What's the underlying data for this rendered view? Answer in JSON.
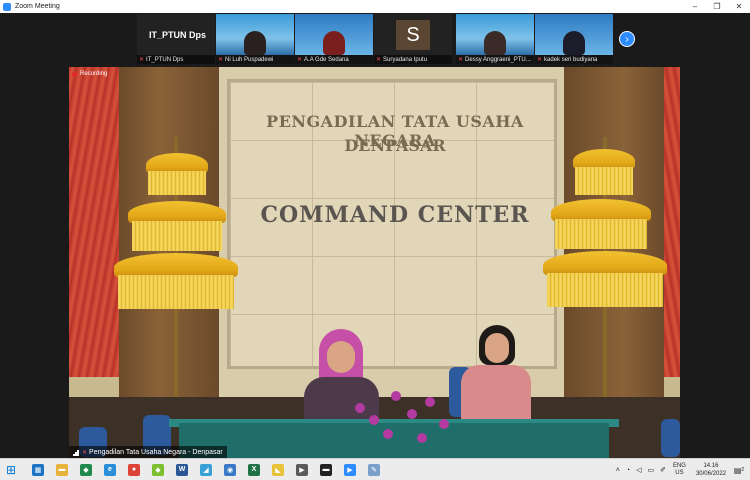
{
  "window": {
    "title": "Zoom Meeting",
    "minimize": "–",
    "maximize": "❐",
    "close": "✕"
  },
  "thumbnails": [
    {
      "id": "t1",
      "name": "IT_PTUN Dps",
      "display_name": "IT_PTUN Dps",
      "muted": true
    },
    {
      "id": "t2",
      "name": "Ni Luh Puspadewi",
      "muted": true
    },
    {
      "id": "t3",
      "name": "A.A Gde Sedana",
      "muted": true
    },
    {
      "id": "t4",
      "name": "Suryadana Iputu",
      "initial": "S",
      "muted": true
    },
    {
      "id": "t5",
      "name": "Dessy Anggraeni_PTU...",
      "muted": true
    },
    {
      "id": "t6",
      "name": "kadek seri budiyana",
      "muted": true
    }
  ],
  "next_page": "›",
  "main": {
    "recording_label": "Recording",
    "sign_line1": "PENGADILAN TATA USAHA NEGARA",
    "sign_line2": "DENPASAR",
    "sign_line3": "COMMAND CENTER",
    "speaker_name": "Pengadilan Tata Usaha Negara - Denpasar"
  },
  "taskbar": {
    "start": "⊞",
    "apps": [
      {
        "name": "calculator",
        "glyph": "▦",
        "color": "#1d74c5"
      },
      {
        "name": "file-explorer",
        "glyph": "▬",
        "color": "#e8b33a"
      },
      {
        "name": "app-green",
        "glyph": "◆",
        "color": "#1f8a4c"
      },
      {
        "name": "edge",
        "glyph": "e",
        "color": "#2a8fd8"
      },
      {
        "name": "chrome",
        "glyph": "●",
        "color": "#db4437"
      },
      {
        "name": "app-lime",
        "glyph": "◆",
        "color": "#7cbf2f"
      },
      {
        "name": "word",
        "glyph": "W",
        "color": "#2b5797"
      },
      {
        "name": "app-cyan",
        "glyph": "◢",
        "color": "#3aa0d8"
      },
      {
        "name": "browser-blue",
        "glyph": "◉",
        "color": "#3a78c8"
      },
      {
        "name": "excel",
        "glyph": "X",
        "color": "#217346"
      },
      {
        "name": "app-yellow",
        "glyph": "◣",
        "color": "#e8c238"
      },
      {
        "name": "media",
        "glyph": "▶",
        "color": "#5a5a5a"
      },
      {
        "name": "display",
        "glyph": "▬",
        "color": "#222222"
      },
      {
        "name": "zoom",
        "glyph": "▶",
        "color": "#2d8cff"
      },
      {
        "name": "paint",
        "glyph": "✎",
        "color": "#7a9fc8"
      }
    ],
    "tray": {
      "lang1": "ENG",
      "lang2": "US",
      "time": "14.16",
      "date": "30/06/2022",
      "notifications": "2"
    }
  }
}
